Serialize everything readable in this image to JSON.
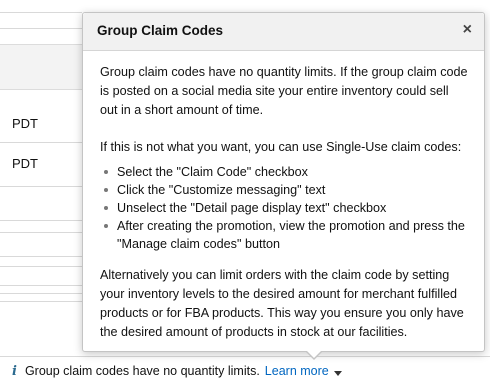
{
  "background": {
    "row_values": [
      "PDT",
      "PDT"
    ]
  },
  "popover": {
    "title": "Group Claim Codes",
    "close_symbol": "×",
    "paragraph_1": "Group claim codes have no quantity limits. If the group claim code is posted on a social media site your entire inventory could sell out in a short amount of time.",
    "paragraph_2": "If this is not what you want, you can use Single-Use claim codes:",
    "steps": [
      "Select the \"Claim Code\" checkbox",
      "Click the \"Customize messaging\" text",
      "Unselect the \"Detail page display text\" checkbox",
      "After creating the promotion, view the promotion and press the \"Manage claim codes\" button"
    ],
    "paragraph_3": "Alternatively you can limit orders with the claim code by setting your inventory levels to the desired amount for merchant fulfilled products or for FBA products. This way you ensure you only have the desired amount of products in stock at our facilities."
  },
  "info_line": {
    "icon": "info-icon",
    "icon_glyph": "i",
    "text": "Group claim codes have no quantity limits.",
    "link_label": "Learn more",
    "link_icon": "caret-down-icon"
  },
  "colors": {
    "link": "#0066c0",
    "info_icon": "#2b6a8f",
    "header_bg": "#f1f1f1"
  }
}
